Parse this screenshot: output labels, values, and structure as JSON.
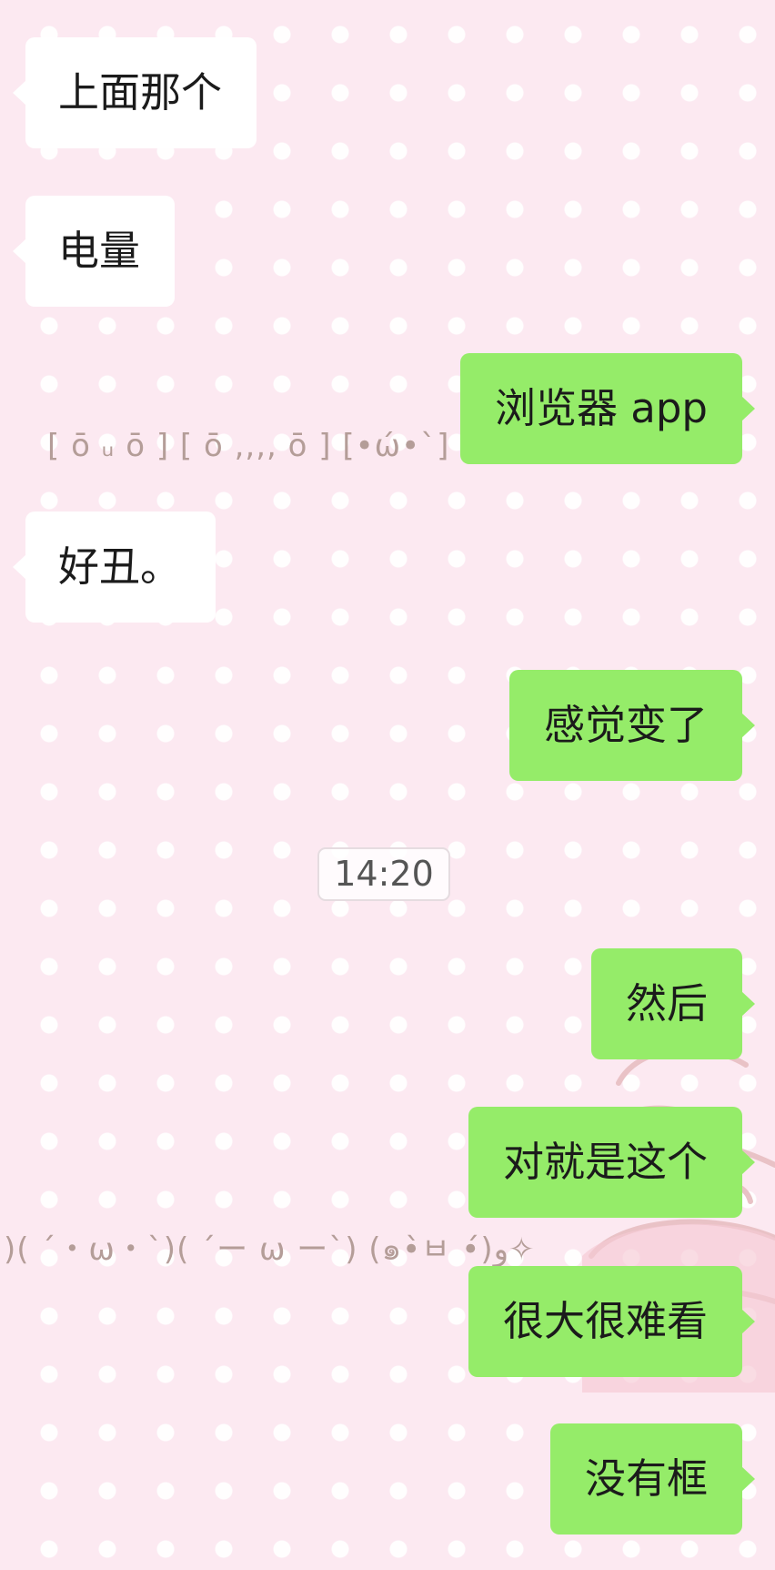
{
  "messages": [
    {
      "side": "left",
      "text": "上面那个"
    },
    {
      "side": "left",
      "text": "电量"
    },
    {
      "side": "right",
      "text": "浏览器 app"
    },
    {
      "side": "left",
      "text": "好丑。"
    },
    {
      "side": "right",
      "text": "感觉变了"
    },
    {
      "side": "right",
      "text": "然后"
    },
    {
      "side": "right",
      "text": "对就是这个"
    },
    {
      "side": "right",
      "text": "很大很难看"
    },
    {
      "side": "right",
      "text": "没有框"
    }
  ],
  "timestamp": "14:20",
  "kaomoji": {
    "row_1": "[ ō ᵤ ō ] [ ō ,,,, ō ] [•ώ•ˋ]",
    "row_2": ")( ´・ω・`)( ´ー ω ー`) (๑•̀ㅂ •́)و✧"
  },
  "colors": {
    "background": "#fce9f1",
    "incoming_bubble": "#ffffff",
    "outgoing_bubble": "#95ec69",
    "kaomoji_text": "#b49d98"
  }
}
